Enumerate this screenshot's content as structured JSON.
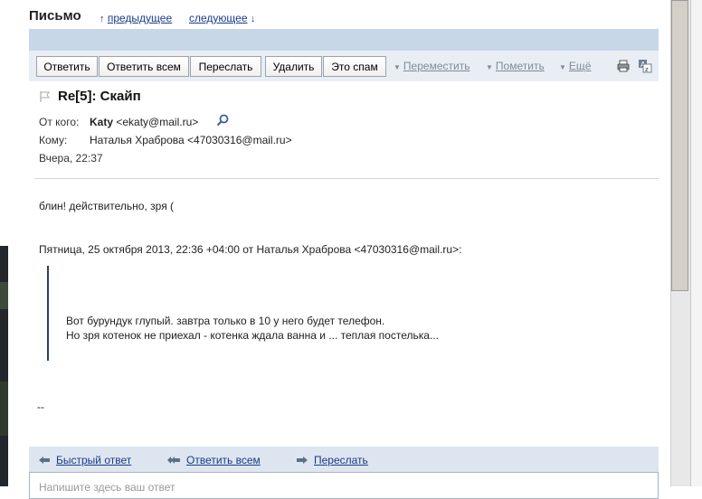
{
  "page": {
    "title": "Письмо",
    "prev_label": "предыдущее",
    "prev_arrow": "↑",
    "next_label": "следующее",
    "next_arrow": "↓"
  },
  "toolbar": {
    "reply": "Ответить",
    "reply_all": "Ответить всем",
    "forward": "Переслать",
    "delete": "Удалить",
    "spam": "Это спам",
    "move": "Переместить",
    "mark": "Пометить",
    "more": "Ещё",
    "print_icon": "printer-icon",
    "translate_icon": "translate-icon"
  },
  "message": {
    "subject": "Re[5]: Скайп",
    "from_label": "От кого:",
    "from_name": "Katy",
    "from_email": "<ekaty@mail.ru>",
    "to_label": "Кому:",
    "to_value": "Наталья Храброва <47030316@mail.ru>",
    "date": "Вчера, 22:37"
  },
  "body": {
    "line1": "блин! действительно, зря (",
    "quote_header": "Пятница, 25 октября 2013, 22:36 +04:00 от Наталья Храброва <47030316@mail.ru>:",
    "quote_line1": "Вот бурундук глупый. завтра только в 10 у него будет телефон.",
    "quote_line2": "Но зря котенок не приехал - котенка ждала ванна и ... теплая постелька...",
    "signature": "--"
  },
  "quick_reply": {
    "quick": "Быстрый ответ",
    "reply_all": "Ответить всем",
    "forward": "Переслать",
    "placeholder": "Напишите здесь ваш ответ"
  },
  "colors": {
    "link": "#1a3a8a",
    "header_band": "#c7d7e8",
    "toolbar_bg": "#e9eef4",
    "reply_bar": "#dde6f0"
  }
}
